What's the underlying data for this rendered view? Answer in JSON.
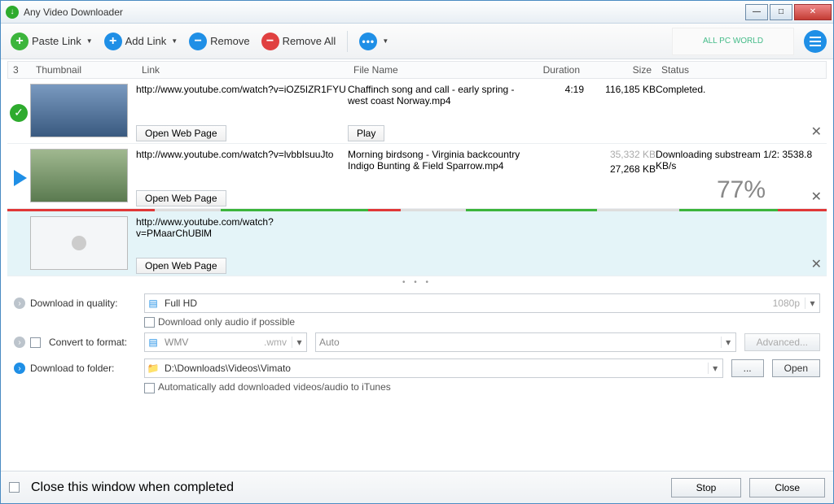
{
  "app": {
    "title": "Any Video Downloader",
    "logo_text": "ALL PC WORLD"
  },
  "toolbar": {
    "paste": "Paste Link",
    "add": "Add Link",
    "remove": "Remove",
    "removeAll": "Remove All"
  },
  "headers": {
    "idx": "3",
    "thumb": "Thumbnail",
    "link": "Link",
    "file": "File Name",
    "dur": "Duration",
    "size": "Size",
    "status": "Status"
  },
  "rows": [
    {
      "link": "http://www.youtube.com/watch?v=iOZ5IZR1FYU",
      "file": "Chaffinch song and call - early spring - west coast Norway.mp4",
      "dur": "4:19",
      "size": "116,185 KB",
      "status": "Completed.",
      "open": "Open Web Page",
      "play": "Play"
    },
    {
      "link": "http://www.youtube.com/watch?v=lvbbIsuuJto",
      "file": "Morning birdsong - Virginia backcountry Indigo Bunting & Field Sparrow.mp4",
      "dur": "",
      "sizeTotal": "35,332 KB",
      "sizeDone": "27,268 KB",
      "status": "Downloading substream 1/2: 3538.8 KB/s",
      "percent": "77%",
      "open": "Open Web Page"
    },
    {
      "link": "http://www.youtube.com/watch?v=PMaarChUBlM",
      "file": "",
      "dur": "",
      "size": "",
      "status": "",
      "open": "Open Web Page"
    }
  ],
  "settings": {
    "qualityLabel": "Download in quality:",
    "qualityValue": "Full HD",
    "qualitySuffix": "1080p",
    "audioOnly": "Download only audio if possible",
    "convertLabel": "Convert to format:",
    "convertValue": "WMV",
    "convertExt": ".wmv",
    "convertAuto": "Auto",
    "advanced": "Advanced...",
    "folderLabel": "Download to folder:",
    "folderValue": "D:\\Downloads\\Videos\\Vimato",
    "browse": "...",
    "open": "Open",
    "itunes": "Automatically add downloaded videos/audio to iTunes"
  },
  "footer": {
    "closeWhenDone": "Close this window when completed",
    "stop": "Stop",
    "close": "Close"
  }
}
